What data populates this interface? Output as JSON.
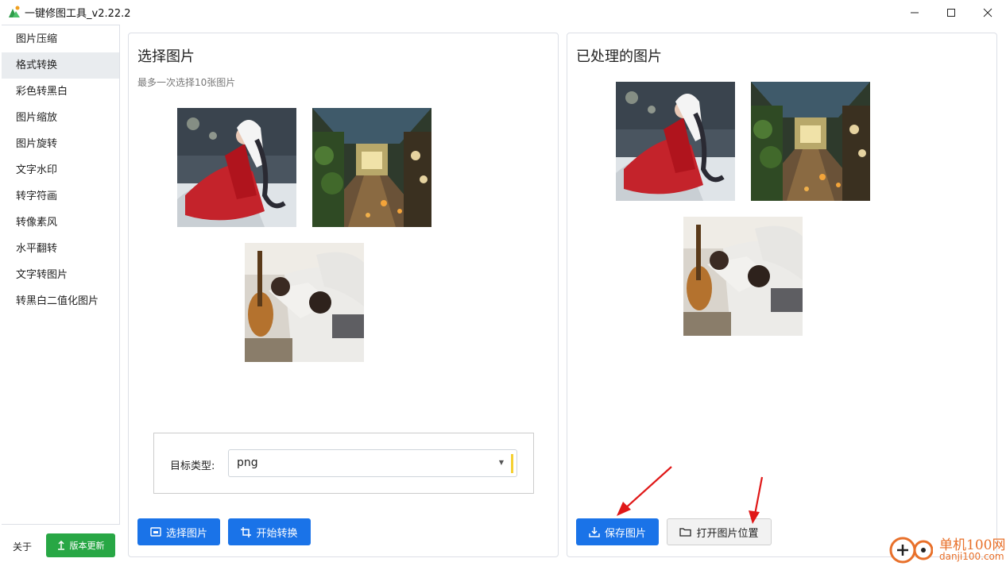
{
  "window": {
    "title": "一键修图工具_v2.22.2",
    "controls": [
      "minimize",
      "maximize",
      "close"
    ]
  },
  "sidebar": {
    "items": [
      {
        "label": "图片压缩",
        "active": false
      },
      {
        "label": "格式转换",
        "active": true
      },
      {
        "label": "彩色转黑白",
        "active": false
      },
      {
        "label": "图片缩放",
        "active": false
      },
      {
        "label": "图片旋转",
        "active": false
      },
      {
        "label": "文字水印",
        "active": false
      },
      {
        "label": "转字符画",
        "active": false
      },
      {
        "label": "转像素风",
        "active": false
      },
      {
        "label": "水平翻转",
        "active": false
      },
      {
        "label": "文字转图片",
        "active": false
      },
      {
        "label": "转黑白二值化图片",
        "active": false
      }
    ],
    "about_label": "关于",
    "update_label": "版本更新",
    "update_color": "#28a745"
  },
  "left_panel": {
    "title": "选择图片",
    "subtitle": "最多一次选择10张图片",
    "images": [
      "girl-in-red-snow",
      "greenhouse-corridor",
      "girl-on-sofa-guitar"
    ],
    "target_label": "目标类型:",
    "target_value": "png",
    "select_button": "选择图片",
    "convert_button": "开始转换"
  },
  "right_panel": {
    "title": "已处理的图片",
    "images": [
      "girl-in-red-snow",
      "greenhouse-corridor",
      "girl-on-sofa-guitar"
    ],
    "save_button": "保存图片",
    "open_location_button": "打开图片位置"
  },
  "accent_color": "#1a73e8",
  "watermark": {
    "cn": "单机100网",
    "en": "danji100.com"
  }
}
